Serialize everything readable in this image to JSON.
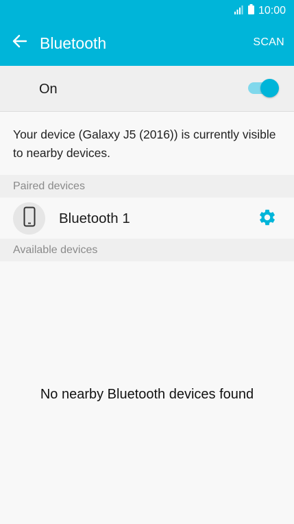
{
  "status_bar": {
    "time": "10:00",
    "icons": [
      "signal-icon",
      "battery-icon"
    ]
  },
  "app_bar": {
    "title": "Bluetooth",
    "back_icon": "arrow-left-icon",
    "scan_label": "SCAN"
  },
  "toggle": {
    "label": "On",
    "state": true
  },
  "visibility_message": "Your device (Galaxy J5 (2016)) is currently visible to nearby devices.",
  "sections": {
    "paired": {
      "header": "Paired devices",
      "devices": [
        {
          "name": "Bluetooth 1",
          "icon": "phone-icon",
          "action_icon": "gear-icon"
        }
      ]
    },
    "available": {
      "header": "Available devices",
      "empty_message": "No nearby Bluetooth devices found"
    }
  },
  "colors": {
    "accent": "#00b5d9",
    "switch_track": "#80d8ec",
    "section_bg": "#efefef",
    "page_bg": "#f8f8f8",
    "section_text": "#8a8a8a"
  }
}
